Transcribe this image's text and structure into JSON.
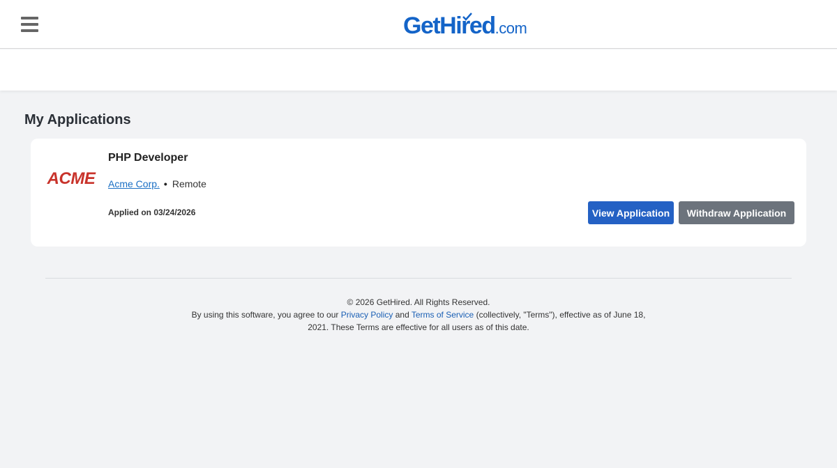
{
  "header": {
    "logo_main": "GetHired",
    "logo_suffix": ".com",
    "menu_icon": "hamburger-menu-icon"
  },
  "main": {
    "title": "My Applications",
    "applications": [
      {
        "company_logo_text": "ACME",
        "job_title": "PHP Developer",
        "company": "Acme Corp.",
        "separator": "•",
        "location": "Remote",
        "applied": "Applied on 03/24/2026",
        "view_label": "View Application",
        "withdraw_label": "Withdraw Application"
      }
    ]
  },
  "footer": {
    "copyright": "© 2026 GetHired. All Rights Reserved.",
    "terms_prefix": "By using this software, you agree to our ",
    "privacy_link": "Privacy Policy",
    "and": " and ",
    "terms_link": "Terms of Service",
    "terms_suffix": " (collectively, \"Terms\"), effective as of June 18, 2021. These Terms are effective for all users as of this date."
  },
  "colors": {
    "brand": "#1464c8",
    "primary_button": "#2461c4",
    "secondary_button": "#6c737c",
    "acme_red": "#c8332b",
    "background": "#f2f3f5"
  }
}
